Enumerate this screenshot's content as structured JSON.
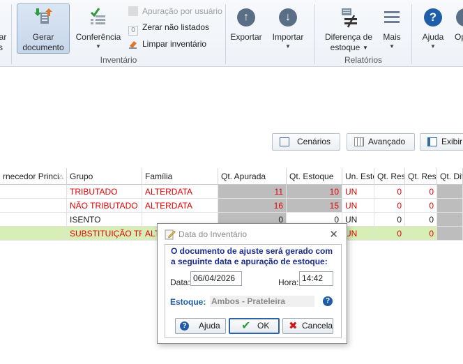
{
  "ribbon": {
    "left_cut_top": "car",
    "left_cut_bottom": "s",
    "gerar_line1": "Gerar",
    "gerar_line2": "documento",
    "conferencia": "Conferência",
    "apuracao": "Apuração por usuário",
    "zerar": "Zerar não listados",
    "limpar": "Limpar inventário",
    "exportar": "Exportar",
    "importar": "Importar",
    "diferenca_line1": "Diferença de",
    "diferenca_line2": "estoque",
    "mais": "Mais",
    "ajuda": "Ajuda",
    "right_cut": "Op",
    "group_inventario": "Inventário",
    "group_relatorios": "Relatórios"
  },
  "toolbar": {
    "cenarios": "Cenários",
    "avancado": "Avançado",
    "exibir": "Exibir"
  },
  "grid": {
    "headers": [
      "rnecedor Princi",
      "Grupo",
      "Família",
      "Qt. Apurada",
      "Qt. Estoque",
      "Un. Esto",
      "Qt. Res",
      "Qt. Rese",
      "Qt. Dif"
    ],
    "rows": [
      {
        "grupo": "TRIBUTADO",
        "familia": "ALTERDATA",
        "apurada": "11",
        "estoque": "10",
        "un": "UN",
        "res": "0",
        "rese": "0"
      },
      {
        "grupo": "NÃO TRIBUTADO",
        "familia": "ALTERDATA",
        "apurada": "16",
        "estoque": "15",
        "un": "UN",
        "res": "0",
        "rese": "0"
      },
      {
        "grupo": "ISENTO",
        "familia": "",
        "apurada": "0",
        "estoque": "0",
        "un": "UN",
        "res": "0",
        "rese": "0"
      },
      {
        "grupo": "SUBSTITUIÇÃO TRIB",
        "familia": "ALT",
        "apurada": "",
        "estoque": "",
        "un": "UN",
        "res": "0",
        "rese": "0"
      }
    ]
  },
  "dialog": {
    "title": "Data do Inventário",
    "message_line1": "O documento de ajuste será gerado com",
    "message_line2": "a seguinte data e apuração de estoque:",
    "data_label": "Data:",
    "data_value": "06/04/2026",
    "hora_label": "Hora:",
    "hora_value": "14:42",
    "estoque_label": "Estoque:",
    "estoque_value": "Ambos - Prateleira",
    "btn_ajuda": "Ajuda",
    "btn_ok": "OK",
    "btn_cancela": "Cancela"
  },
  "colors": {
    "red_text": "#e00000",
    "highlight_row": "#d7efb6",
    "dialog_message": "#1b2a8c",
    "grey_cell": "#bdbdbd"
  }
}
